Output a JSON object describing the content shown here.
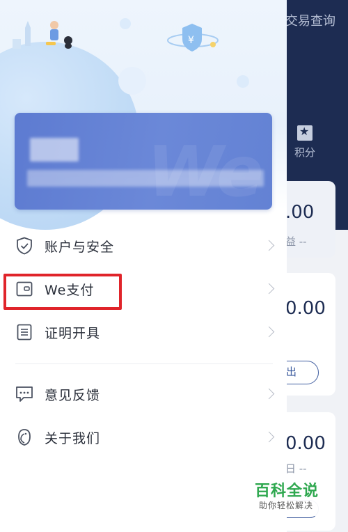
{
  "background_app": {
    "title": "交易查询",
    "points_label": "积分",
    "card1_amount": ".00",
    "card1_sub": "益 --",
    "card2_amount": "0.00",
    "card2_button": "出",
    "card3_amount": "0.00",
    "card3_sub": "日 --"
  },
  "drawer": {
    "menu": [
      {
        "label": "账户与安全",
        "icon": "shield-check-icon"
      },
      {
        "label": "We支付",
        "icon": "wallet-icon"
      },
      {
        "label": "证明开具",
        "icon": "document-list-icon"
      },
      {
        "label": "意见反馈",
        "icon": "chat-bubble-icon"
      },
      {
        "label": "关于我们",
        "icon": "penguin-icon"
      }
    ]
  },
  "logo": {
    "main": "百科全说",
    "sub": "助你轻松解决"
  },
  "colors": {
    "header_navy": "#1d2c52",
    "profile_card": "#6382d4",
    "highlight_red": "#e0242a",
    "logo_green": "#2fa84f"
  }
}
